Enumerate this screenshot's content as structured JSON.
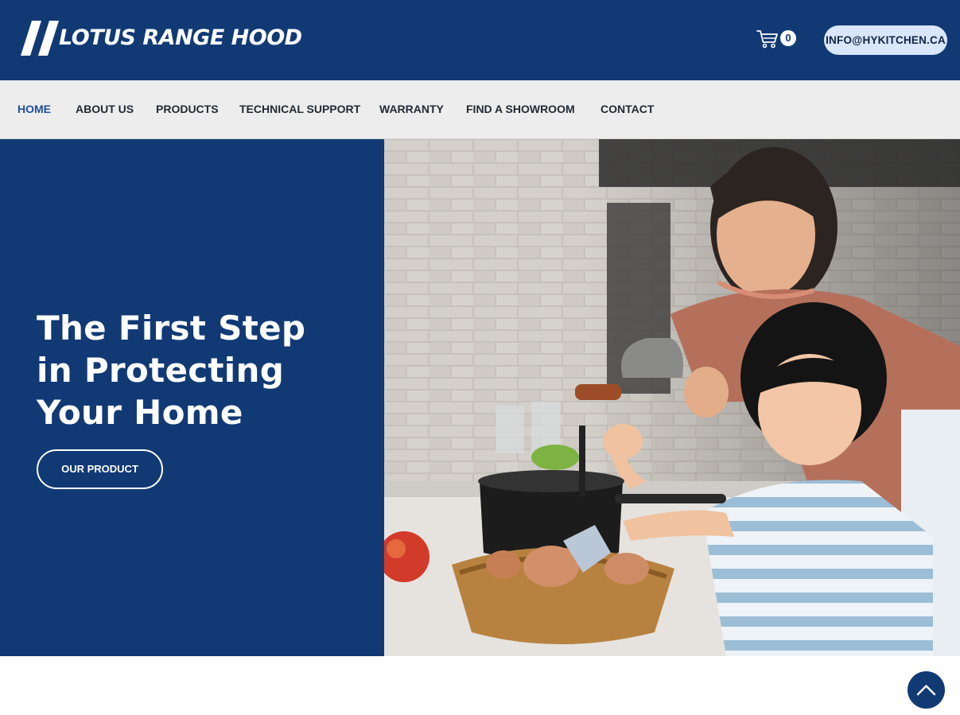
{
  "header": {
    "logo_text": "LOTUS RANGE HOOD",
    "cart": {
      "icon": "cart-icon",
      "count": "0"
    },
    "email_button": "INFO@HYKITCHEN.CA"
  },
  "nav": {
    "items": [
      {
        "label": "HOME",
        "active": true
      },
      {
        "label": "ABOUT US",
        "active": false
      },
      {
        "label": "PRODUCTS",
        "active": false
      },
      {
        "label": "TECHNICAL SUPPORT",
        "active": false
      },
      {
        "label": "WARRANTY",
        "active": false
      },
      {
        "label": "FIND A SHOWROOM",
        "active": false
      },
      {
        "label": "CONTACT",
        "active": false
      }
    ]
  },
  "hero": {
    "title_lines": [
      "The First Step",
      "in Protecting",
      "Your Home"
    ],
    "cta_label": "OUR PRODUCT"
  },
  "scroll_top": {
    "icon": "chevron-up-icon"
  },
  "colors": {
    "brand_navy": "#113a75",
    "nav_bg": "#ededed",
    "nav_active": "#1e4f99",
    "email_button_bg": "#d9e6fb"
  }
}
